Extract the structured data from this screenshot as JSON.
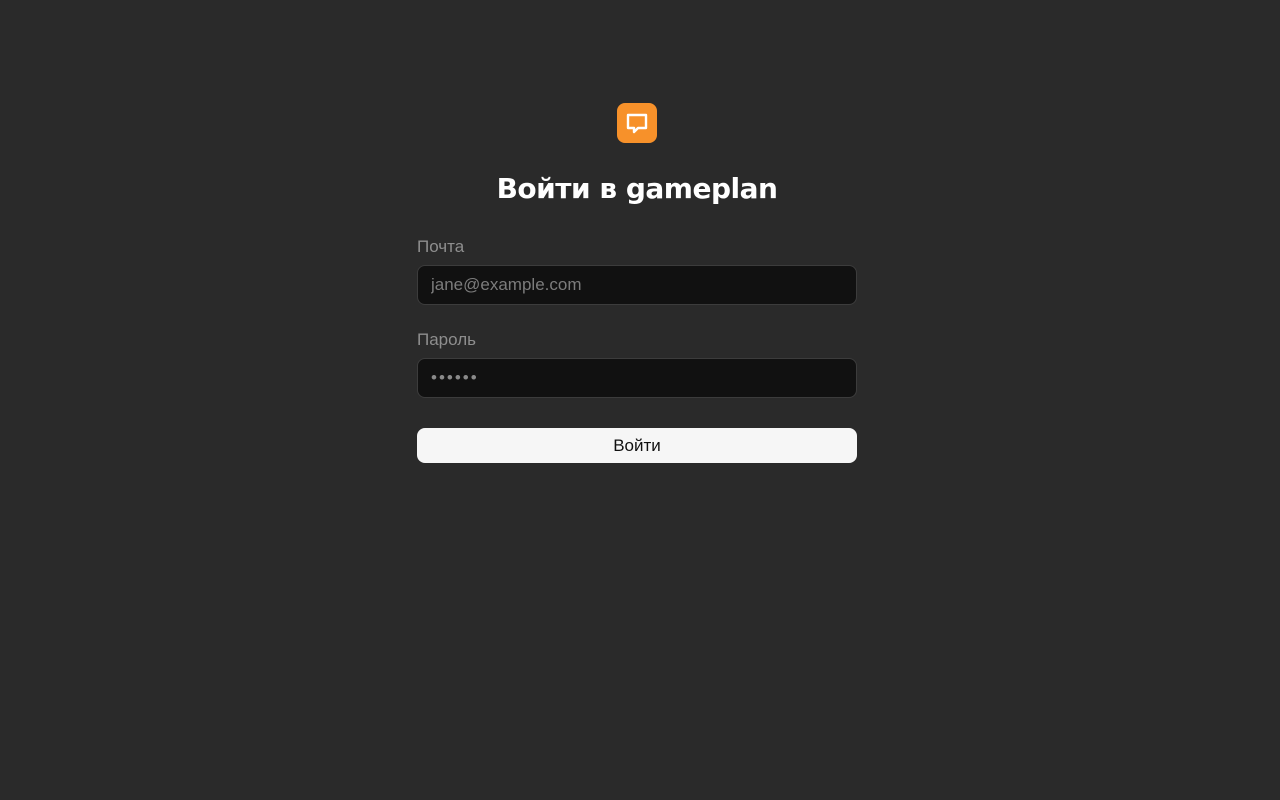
{
  "brand": {
    "logo_icon": "chat-bubble-icon",
    "accent_color": "#f7912a"
  },
  "title": "Войти в gameplan",
  "form": {
    "email": {
      "label": "Почта",
      "placeholder": "jane@example.com"
    },
    "password": {
      "label": "Пароль",
      "placeholder": "••••••"
    },
    "submit_label": "Войти"
  }
}
